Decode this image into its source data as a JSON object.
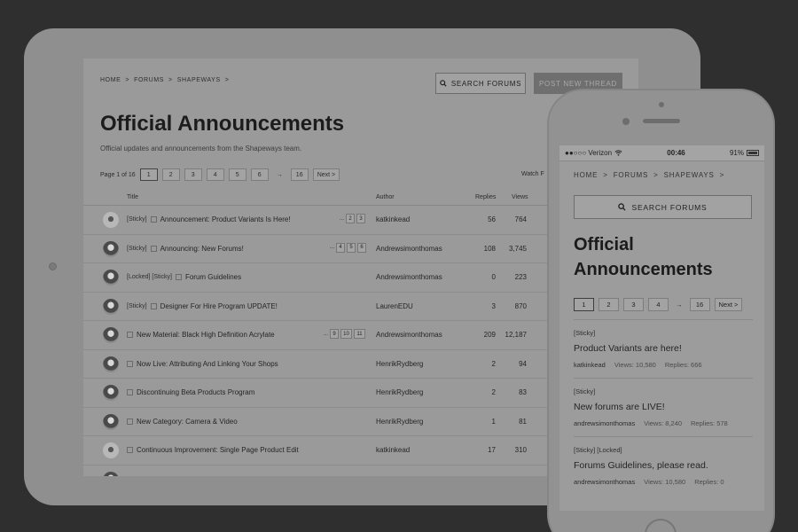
{
  "tablet": {
    "breadcrumb": [
      "HOME",
      ">",
      "FORUMS",
      ">",
      "SHAPEWAYS",
      ">"
    ],
    "search_label": "SEARCH FORUMS",
    "post_label": "POST NEW THREAD",
    "title": "Official Announcements",
    "description": "Official updates and announcements from the Shapeways team.",
    "pager": {
      "label": "Page 1 of 16",
      "pages": [
        "1",
        "2",
        "3",
        "4",
        "5",
        "6"
      ],
      "arrow": "→",
      "last": "16",
      "next": "Next >",
      "watch": "Watch F"
    },
    "columns": {
      "title": "Title",
      "author": "Author",
      "replies": "Replies",
      "views": "Views"
    },
    "rows": [
      {
        "tags": "[Sticky]",
        "title": "Announcement: Product Variants Is Here!",
        "pages": [
          "...",
          "2",
          "3"
        ],
        "author": "katkinkead",
        "replies": "56",
        "views": "764"
      },
      {
        "tags": "[Sticky]",
        "title": "Announcing: New Forums!",
        "pages": [
          "...",
          "4",
          "5",
          "6"
        ],
        "author": "Andrewsimonthomas",
        "replies": "108",
        "views": "3,745"
      },
      {
        "tags": "[Locked] [Sticky]",
        "title": "Forum Guidelines",
        "pages": [],
        "author": "Andrewsimonthomas",
        "replies": "0",
        "views": "223"
      },
      {
        "tags": "[Sticky]",
        "title": "Designer For Hire Program UPDATE!",
        "pages": [],
        "author": "LaurenEDU",
        "replies": "3",
        "views": "870"
      },
      {
        "tags": "",
        "title": "New Material: Black High Definition Acrylate",
        "pages": [
          "...",
          "9",
          "10",
          "11"
        ],
        "author": "Andrewsimonthomas",
        "replies": "209",
        "views": "12,187"
      },
      {
        "tags": "",
        "title": "Now Live: Attributing And Linking Your Shops",
        "pages": [],
        "author": "HenrikRydberg",
        "replies": "2",
        "views": "94"
      },
      {
        "tags": "",
        "title": "Discontinuing Beta Products Program",
        "pages": [],
        "author": "HenrikRydberg",
        "replies": "2",
        "views": "83"
      },
      {
        "tags": "",
        "title": "New Category: Camera & Video",
        "pages": [],
        "author": "HenrikRydberg",
        "replies": "1",
        "views": "81"
      },
      {
        "tags": "",
        "title": "Continuous Improvement: Single Page Product Edit",
        "pages": [],
        "author": "katkinkead",
        "replies": "17",
        "views": "310"
      }
    ]
  },
  "phone": {
    "status": {
      "carrier": "●●○○○ Verizon",
      "time": "00:46",
      "battery": "91%"
    },
    "breadcrumb": [
      "HOME",
      ">",
      "FORUMS",
      ">",
      "SHAPEWAYS",
      ">"
    ],
    "search_label": "SEARCH FORUMS",
    "title": "Official Announcements",
    "pager": {
      "pages": [
        "1",
        "2",
        "3",
        "4"
      ],
      "arrow": "→",
      "last": "16",
      "next": "Next >"
    },
    "threads": [
      {
        "tags": "[Sticky]",
        "title": "Product Variants are here!",
        "author": "katkinkead",
        "views": "Views: 10,580",
        "replies": "Replies: 666"
      },
      {
        "tags": "[Sticky]",
        "title": "New forums are LIVE!",
        "author": "andrewsimonthomas",
        "views": "Views: 8,240",
        "replies": "Replies: 578"
      },
      {
        "tags": "[Sticky] [Locked]",
        "title": "Forums Guidelines, please read.",
        "author": "andrewsimonthomas",
        "views": "Views: 10,580",
        "replies": "Replies: 0"
      }
    ]
  }
}
